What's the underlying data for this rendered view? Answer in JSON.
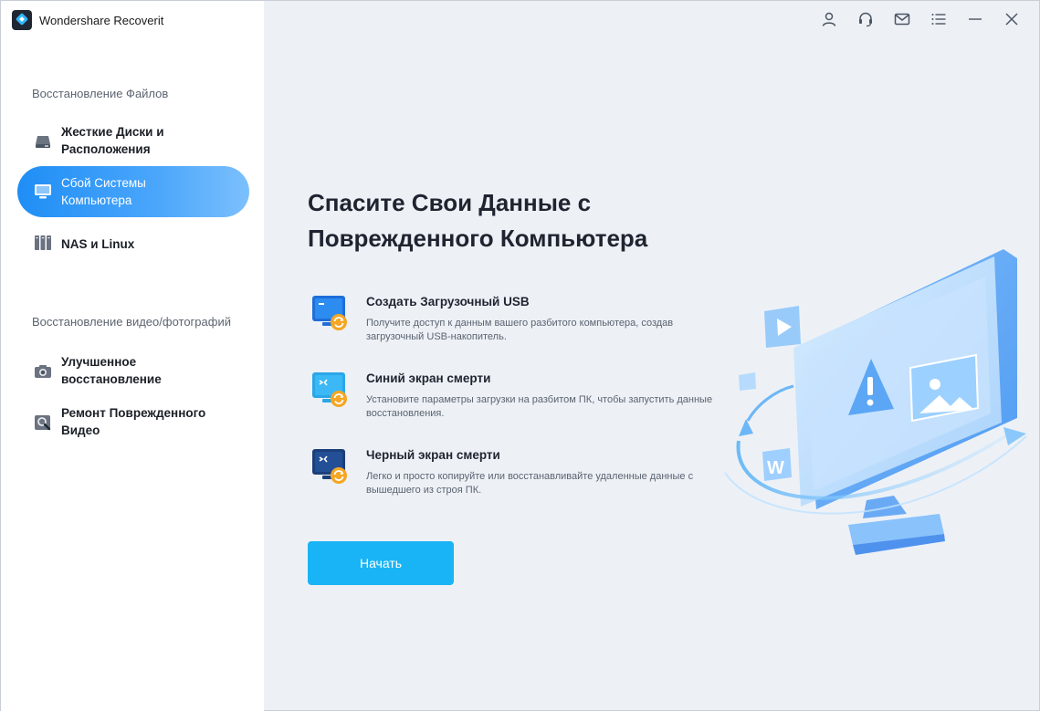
{
  "app": {
    "title": "Wondershare Recoverit"
  },
  "titlebar": {
    "buttons": [
      "account-icon",
      "support-icon",
      "mail-icon",
      "menu-icon",
      "minimize-icon",
      "close-icon"
    ]
  },
  "sidebar": {
    "section1": "Восстановление Файлов",
    "section2": "Восстановление видео/фотографий",
    "items": [
      {
        "line1": "Жесткие Диски и",
        "line2": "Расположения",
        "icon": "hard-drive-icon",
        "active": false
      },
      {
        "line1": "Сбой Системы",
        "line2": "Компьютера",
        "icon": "computer-icon",
        "active": true
      },
      {
        "line1": "NAS и Linux",
        "line2": "",
        "icon": "nas-icon",
        "active": false
      },
      {
        "line1": "Улучшенное",
        "line2": "восстановление",
        "icon": "camera-icon",
        "active": false
      },
      {
        "line1": "Ремонт Поврежденного",
        "line2": "Видео",
        "icon": "video-repair-icon",
        "active": false
      }
    ]
  },
  "main": {
    "headline_line1": "Спасите Свои Данные с",
    "headline_line2": "Поврежденного Компьютера",
    "features": [
      {
        "title": "Создать Загрузочный USB",
        "desc": "Получите доступ к данным вашего разбитого компьютера, создав загрузочный USB-накопитель.",
        "icon": "bootable-usb-icon"
      },
      {
        "title": "Синий экран смерти",
        "desc": "Установите параметры загрузки на разбитом ПК, чтобы запустить данные восстановления.",
        "icon": "blue-screen-icon"
      },
      {
        "title": "Черный экран смерти",
        "desc": "Легко и просто копируйте или восстанавливайте удаленные данные с вышедшего из строя ПК.",
        "icon": "black-screen-icon"
      }
    ],
    "start_label": "Начать"
  },
  "colors": {
    "accent": "#19b4f5",
    "active_nav": "#1f8ef5"
  }
}
